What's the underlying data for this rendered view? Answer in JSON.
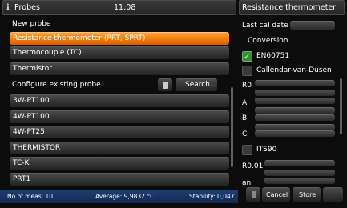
{
  "left_header": {
    "title": "Probes",
    "time": "11:08"
  },
  "right_header": {
    "title": "Resistance thermometer"
  },
  "new_probe": {
    "label": "New probe",
    "types": [
      {
        "label": "Resistance thermometer (PRT, SPRT)",
        "selected": true
      },
      {
        "label": "Thermocouple (TC)",
        "selected": false
      },
      {
        "label": "Thermistor",
        "selected": false
      }
    ]
  },
  "existing": {
    "label": "Configure existing probe",
    "search_label": "Search...",
    "probes": [
      "3W-PT100",
      "4W-PT100",
      "4W-PT25",
      "THERMISTOR",
      "TC-K",
      "PRT1"
    ]
  },
  "status_bar": {
    "meas": "No of meas: 10",
    "average": "Average: 9,9832 °C",
    "stability": "Stability: 0,047"
  },
  "right_panel": {
    "last_cal_label": "Last cal date",
    "conversion_label": "Conversion",
    "en60751_label": "EN60751",
    "en60751_checked": true,
    "cvd_label": "Callendar-van-Dusen",
    "cvd_checked": false,
    "r0_label": "R0",
    "a_label": "A",
    "b_label": "B",
    "c_label": "C",
    "its90_label": "ITS90",
    "its90_checked": false,
    "r001_label": "R0.01",
    "an_label": "an",
    "cancel_label": "Cancel",
    "store_label": "Store"
  },
  "colors": {
    "accent": "#f07800",
    "status_bar": "#1d3f73",
    "checked": "#3a8a3a"
  }
}
